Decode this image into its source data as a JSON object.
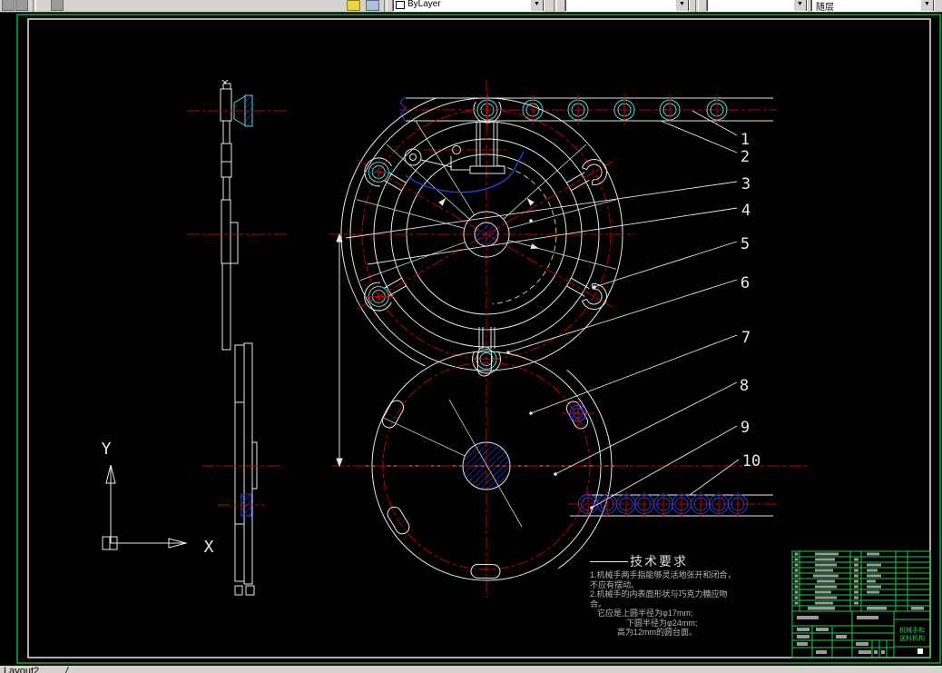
{
  "toolbar": {
    "combo1_value": "ByLayer",
    "combo4_value": "随层"
  },
  "statusbar": {
    "tab_label": "Layout2",
    "divider": "/"
  },
  "ucs": {
    "x": "X",
    "y": "Y"
  },
  "callouts": [
    "1",
    "2",
    "3",
    "4",
    "5",
    "6",
    "7",
    "8",
    "9",
    "10"
  ],
  "tech_req": {
    "title": "技术要求",
    "lines": [
      "1.机械手两手指能够灵活地张开和闭合，",
      "不应有摆动。",
      "2.机械手的内表面形状与巧克力糖应吻",
      "合。",
      "它应是上圆半径为φ17mm;",
      "下圆半径为φ24mm;",
      "高为12mm的圆台面。"
    ]
  },
  "title_block": {
    "product_line1": "机械手和",
    "product_line2": "送料机构"
  }
}
